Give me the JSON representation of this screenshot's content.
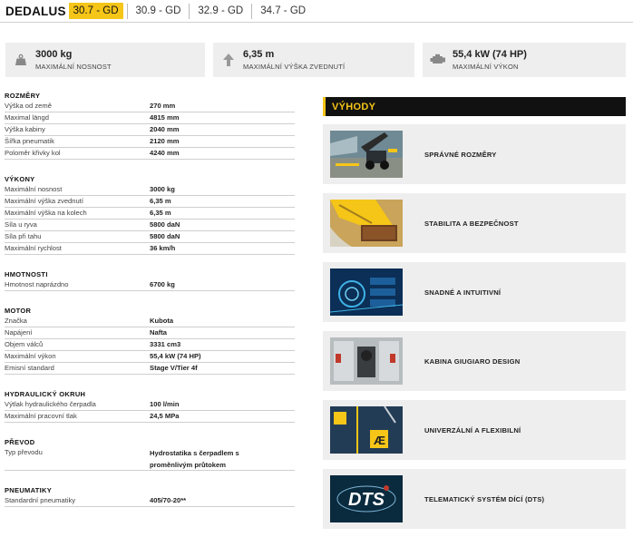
{
  "header": {
    "brand": "DEDALUS",
    "tabs": [
      {
        "label": "30.7 - GD",
        "active": true
      },
      {
        "label": "30.9 - GD",
        "active": false
      },
      {
        "label": "32.9 - GD",
        "active": false
      },
      {
        "label": "34.7 - GD",
        "active": false
      }
    ]
  },
  "cards": [
    {
      "value": "3000 kg",
      "label": "MAXIMÁLNÍ NOSNOST",
      "icon": "weight-icon"
    },
    {
      "value": "6,35 m",
      "label": "MAXIMÁLNÍ VÝŠKA ZVEDNUTÍ",
      "icon": "arrow-up-icon"
    },
    {
      "value": "55,4 kW (74 HP)",
      "label": "MAXIMÁLNÍ VÝKON",
      "icon": "engine-icon"
    }
  ],
  "specs": [
    {
      "title": "ROZMĚRY",
      "rows": [
        {
          "k": "Výška od země",
          "v": "270 mm"
        },
        {
          "k": "Maximal längd",
          "v": "4815 mm"
        },
        {
          "k": "Výška kabiny",
          "v": "2040 mm"
        },
        {
          "k": "Šířka pneumatik",
          "v": "2120 mm"
        },
        {
          "k": "Poloměr křivky kol",
          "v": "4240 mm"
        }
      ]
    },
    {
      "title": "VÝKONY",
      "rows": [
        {
          "k": "Maximální nosnost",
          "v": "3000 kg"
        },
        {
          "k": "Maximální výška zvednutí",
          "v": "6,35 m"
        },
        {
          "k": "Maximální výška na kolech",
          "v": "6,35 m"
        },
        {
          "k": "Síla u ryva",
          "v": "5800 daN"
        },
        {
          "k": "Síla při tahu",
          "v": "5800 daN"
        },
        {
          "k": "Maximální rychlost",
          "v": "36 km/h"
        }
      ]
    },
    {
      "title": "HMOTNOSTI",
      "rows": [
        {
          "k": "Hmotnost naprázdno",
          "v": "6700 kg"
        }
      ]
    },
    {
      "title": "MOTOR",
      "rows": [
        {
          "k": "Značka",
          "v": "Kubota"
        },
        {
          "k": "Napájení",
          "v": "Nafta"
        },
        {
          "k": "Objem válců",
          "v": "3331 cm3"
        },
        {
          "k": "Maximální výkon",
          "v": "55,4 kW (74 HP)"
        },
        {
          "k": "Emisní standard",
          "v": "Stage V/Tier 4f"
        }
      ]
    },
    {
      "title": "HYDRAULICKÝ OKRUH",
      "rows": [
        {
          "k": "Výtlak hydraulického čerpadla",
          "v": "100 l/min"
        },
        {
          "k": "Maximální pracovní tlak",
          "v": "24,5 MPa"
        }
      ]
    },
    {
      "title": "PŘEVOD",
      "rows": [
        {
          "k": "Typ převodu",
          "v": "Hydrostatika s čerpadlem s proměnlivým průtokem",
          "tall": true
        }
      ]
    },
    {
      "title": "PNEUMATIKY",
      "rows": [
        {
          "k": "Standardní pneumatiky",
          "v": "405/70-20**"
        }
      ]
    }
  ],
  "advantages": {
    "title": "VÝHODY",
    "items": [
      {
        "label": "SPRÁVNÉ ROZMĚRY",
        "thumb": "telehandler-lift-thumbnail"
      },
      {
        "label": "STABILITA A BEZPEČNOST",
        "thumb": "stability-boom-thumbnail"
      },
      {
        "label": "SNADNÉ A INTUITIVNÍ",
        "thumb": "digital-interface-thumbnail"
      },
      {
        "label": "KABINA GIUGIARO DESIGN",
        "thumb": "cabin-interior-thumbnail"
      },
      {
        "label": "UNIVERZÁLNÍ A FLEXIBILNÍ",
        "thumb": "attachments-thumbnail"
      },
      {
        "label": "TELEMATICKÝ SYSTÉM DÍCÍ (DTS)",
        "thumb": "dts-logo-thumbnail"
      }
    ]
  },
  "colors": {
    "accent": "#f5c518",
    "card_bg": "#eeeeee",
    "dark": "#111111"
  }
}
